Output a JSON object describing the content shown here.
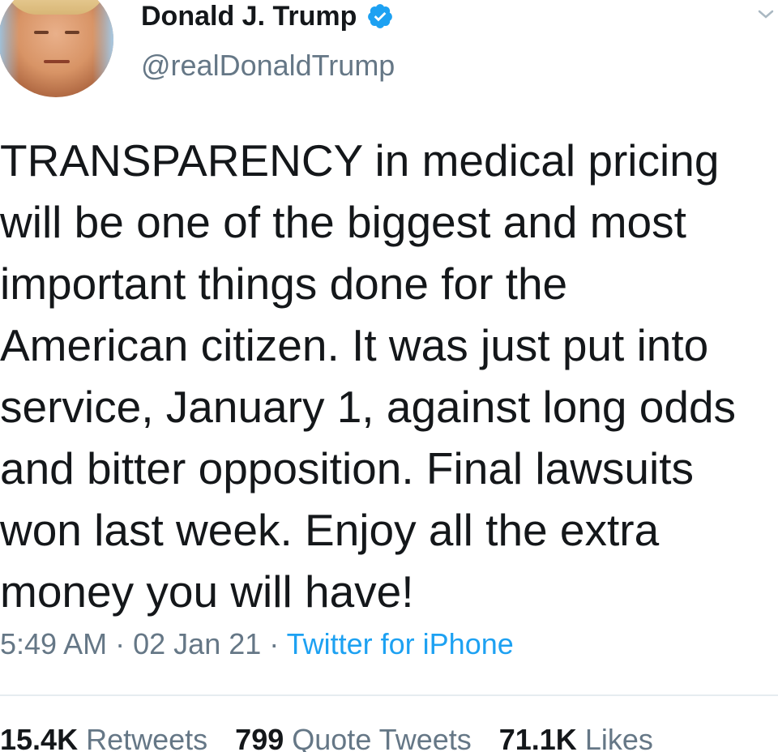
{
  "author": {
    "name": "Donald J. Trump",
    "handle": "@realDonaldTrump",
    "verified": true
  },
  "tweet": {
    "lines": [
      "TRANSPARENCY in medical pricing",
      "will be one of the biggest and most",
      "important things done for the",
      "American citizen. It was just put into",
      "service, January 1, against long odds",
      "and bitter opposition. Final lawsuits",
      "won last week. Enjoy all the extra",
      "money you will have!"
    ],
    "time": "5:49 AM",
    "date": "02 Jan 21",
    "separator": "·",
    "source": "Twitter for iPhone"
  },
  "stats": {
    "retweets_count": "15.4K",
    "retweets_label": "Retweets",
    "quotes_count": "799",
    "quotes_label": "Quote Tweets",
    "likes_count": "71.1K",
    "likes_label": "Likes"
  },
  "colors": {
    "verified_blue": "#1da1f2",
    "secondary_text": "#657786",
    "link": "#1da1f2"
  }
}
